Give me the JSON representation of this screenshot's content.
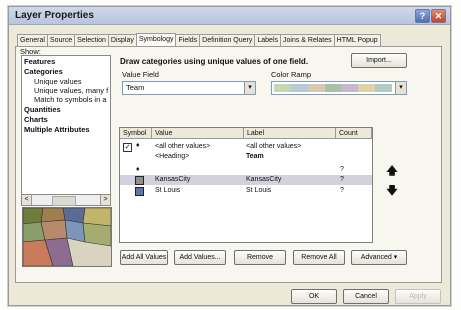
{
  "window": {
    "title": "Layer Properties"
  },
  "tabs": [
    "General",
    "Source",
    "Selection",
    "Display",
    "Symbology",
    "Fields",
    "Definition Query",
    "Labels",
    "Joins & Relates",
    "HTML Popup"
  ],
  "active_tab": "Symbology",
  "show": {
    "label": "Show:",
    "items": [
      {
        "label": "Features",
        "bold": true
      },
      {
        "label": "Categories",
        "bold": true
      },
      {
        "label": "Unique values",
        "bold": false
      },
      {
        "label": "Unique values, many f",
        "bold": false
      },
      {
        "label": "Match to symbols in a",
        "bold": false
      },
      {
        "label": "Quantities",
        "bold": true
      },
      {
        "label": "Charts",
        "bold": true
      },
      {
        "label": "Multiple Attributes",
        "bold": true
      }
    ]
  },
  "heading": "Draw categories using unique values of one field.",
  "import_button": "Import...",
  "value_field": {
    "label": "Value Field",
    "value": "Team"
  },
  "color_ramp": {
    "label": "Color Ramp",
    "colors": [
      "#c7d7b0",
      "#b8c9d9",
      "#d8c8b0",
      "#a9c2a6",
      "#c4b7cf",
      "#dfd3a6",
      "#b3cbc3"
    ]
  },
  "table": {
    "columns": [
      "Symbol",
      "Value",
      "Label",
      "Count"
    ],
    "rows": [
      {
        "value": "<all other values>",
        "label": "<all other values>",
        "count": "",
        "checked": true
      },
      {
        "value": "<Heading>",
        "label": "Team",
        "count": "",
        "bold_label": true
      },
      {
        "value": "",
        "label": "",
        "count": "?"
      },
      {
        "value": "KansasCity",
        "label": "KansasCity",
        "count": "?",
        "selected": true,
        "color": "#8f8f8f"
      },
      {
        "value": "St Louis",
        "label": "St Louis",
        "count": "?",
        "color": "#5a73b9"
      }
    ]
  },
  "bottom_buttons": [
    "Add All Values",
    "Add Values...",
    "Remove",
    "Remove All",
    "Advanced"
  ],
  "dialog_buttons": {
    "ok": "OK",
    "cancel": "Cancel",
    "apply": "Apply"
  },
  "icons": {
    "help": "?",
    "close": "✕",
    "up": "🡅",
    "down": "🡇",
    "left": "<",
    "right": ">"
  },
  "map_colors": [
    "#6e7c3c",
    "#9f7e4f",
    "#5a6b98",
    "#c2b46a",
    "#8a9e6c",
    "#b98a6a",
    "#7c95b8",
    "#a4ac6f",
    "#c97b5c",
    "#8b6d8f"
  ]
}
